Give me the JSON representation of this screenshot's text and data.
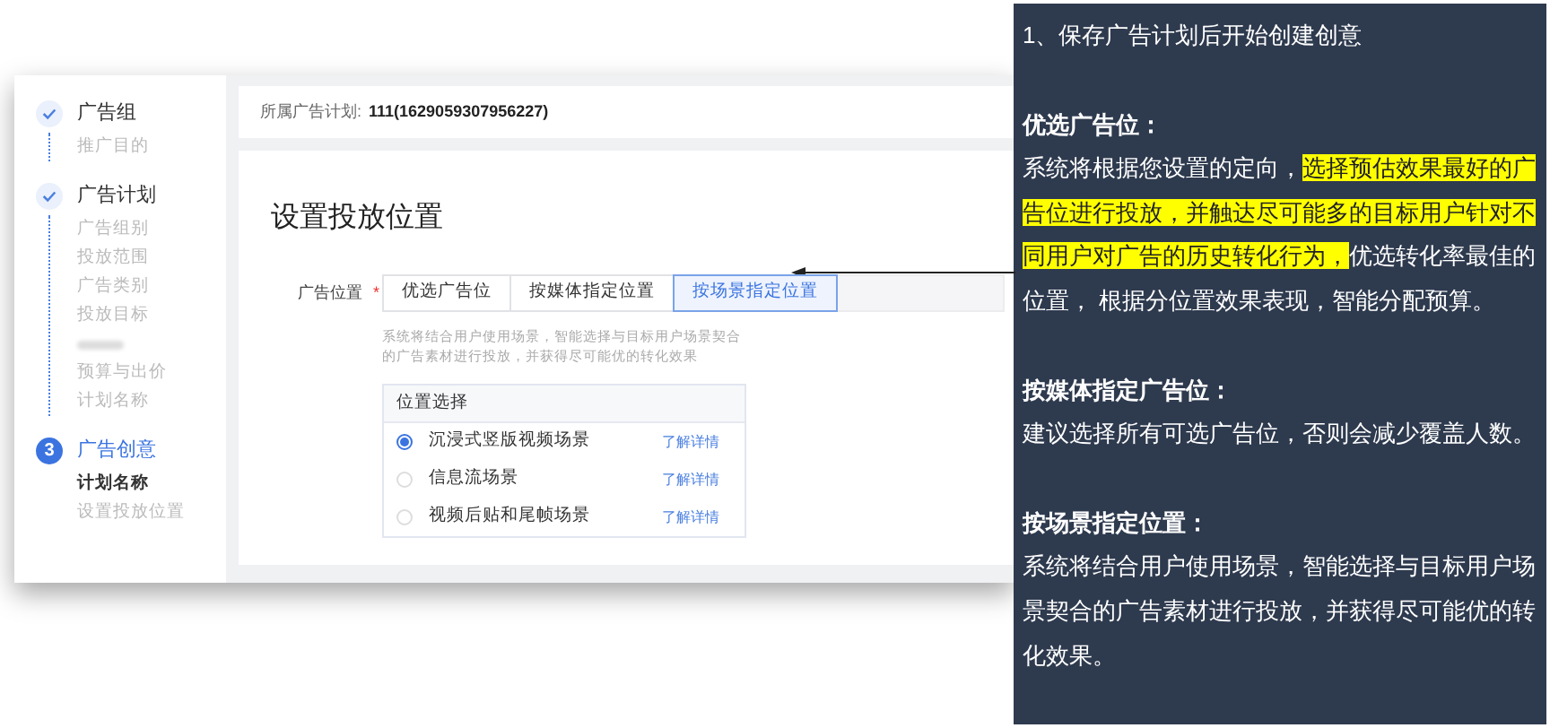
{
  "sidebar": {
    "steps": [
      {
        "title": "广告组",
        "completed": true,
        "items": [
          {
            "label": "推广目的",
            "kind": "text",
            "selected": false
          }
        ]
      },
      {
        "title": "广告计划",
        "completed": true,
        "items": [
          {
            "label": "广告组别",
            "kind": "text",
            "selected": false
          },
          {
            "label": "投放范围",
            "kind": "text",
            "selected": false
          },
          {
            "label": "广告类别",
            "kind": "text",
            "selected": false
          },
          {
            "label": "投放目标",
            "kind": "text",
            "selected": false
          },
          {
            "kind": "blurred"
          },
          {
            "label": "预算与出价",
            "kind": "text",
            "selected": false
          },
          {
            "label": "计划名称",
            "kind": "text",
            "selected": false
          }
        ]
      },
      {
        "title": "广告创意",
        "completed": false,
        "number": "3",
        "items": [
          {
            "label": "计划名称",
            "kind": "text",
            "selected": true
          },
          {
            "label": "设置投放位置",
            "kind": "text",
            "selected": false
          }
        ]
      }
    ]
  },
  "plan_bar": {
    "label": "所属广告计划:",
    "value": "111(1629059307956227)"
  },
  "section_title": "设置投放位置",
  "placement": {
    "label": "广告位置",
    "required_mark": "*",
    "tabs": [
      {
        "label": "优选广告位",
        "selected": false,
        "disabled": false
      },
      {
        "label": "按媒体指定位置",
        "selected": false,
        "disabled": false
      },
      {
        "label": "按场景指定位置",
        "selected": true,
        "disabled": false
      },
      {
        "disabled": true,
        "selected": false
      }
    ],
    "hint": "系统将结合用户使用场景，智能选择与目标用户场景契合的广告素材进行投放，并获得尽可能优的转化效果",
    "table": {
      "header": "位置选择",
      "rows": [
        {
          "label": "沉浸式竖版视频场景",
          "link": "了解详情",
          "selected": true
        },
        {
          "label": "信息流场景",
          "link": "了解详情",
          "selected": false
        },
        {
          "label": "视频后贴和尾帧场景",
          "link": "了解详情",
          "selected": false
        }
      ]
    }
  },
  "note": {
    "title": "1、保存广告计划后开始创建创意",
    "sections": [
      {
        "heading": "优选广告位：",
        "parts": [
          {
            "text": "系统将根据您设置的定向，",
            "highlight": false
          },
          {
            "text": "选择预估效果最好的广告位进行投放，并触达尽可能多的目标用户针对不同用户对广告的历史转化行为，",
            "highlight": true
          },
          {
            "text": "优选转化率最佳的位置， 根据分位置效果表现，智能分配预算。",
            "highlight": false
          }
        ]
      },
      {
        "heading": "按媒体指定广告位：",
        "parts": [
          {
            "text": "建议选择所有可选广告位，否则会减少覆盖人数。",
            "highlight": false
          }
        ]
      },
      {
        "heading": "按场景指定位置：",
        "parts": [
          {
            "text": "系统将结合用户使用场景，智能选择与目标用户场景契合的广告素材进行投放，并获得尽可能优的转化效果。",
            "highlight": false
          }
        ]
      }
    ]
  }
}
